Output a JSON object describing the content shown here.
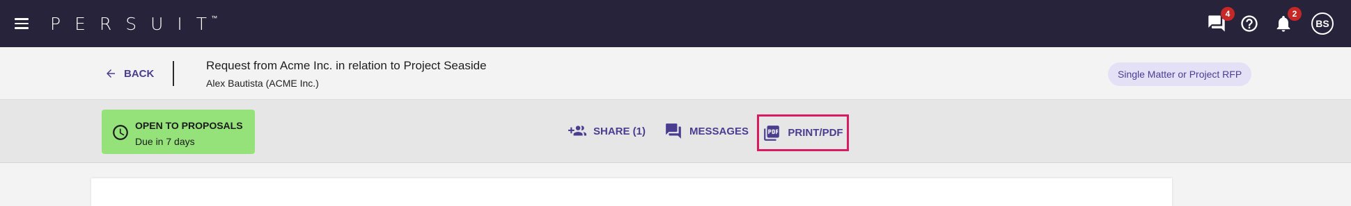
{
  "topbar": {
    "logo_text": "PERSUIT",
    "logo_tm": "™",
    "messages_badge": "4",
    "notifications_badge": "2",
    "avatar_initials": "BS",
    "icons": [
      "menu-icon",
      "chat-icon",
      "help-icon",
      "bell-icon"
    ]
  },
  "header": {
    "back_label": "BACK",
    "title": "Request from Acme Inc. in relation to Project Seaside",
    "subtitle": "Alex Bautista (ACME Inc.)",
    "rfp_type": "Single Matter or Project RFP"
  },
  "actions": {
    "status_title": "OPEN TO PROPOSALS",
    "status_due": "Due in 7 days",
    "share_label": "SHARE (1)",
    "messages_label": "MESSAGES",
    "print_label": "PRINT/PDF"
  },
  "colors": {
    "topbar_bg": "#26233a",
    "accent": "#4a3d8f",
    "status_bg": "#95e27b",
    "badge": "#c62828",
    "highlight_border": "#d81b60",
    "chip_bg": "#e4e1f7"
  }
}
